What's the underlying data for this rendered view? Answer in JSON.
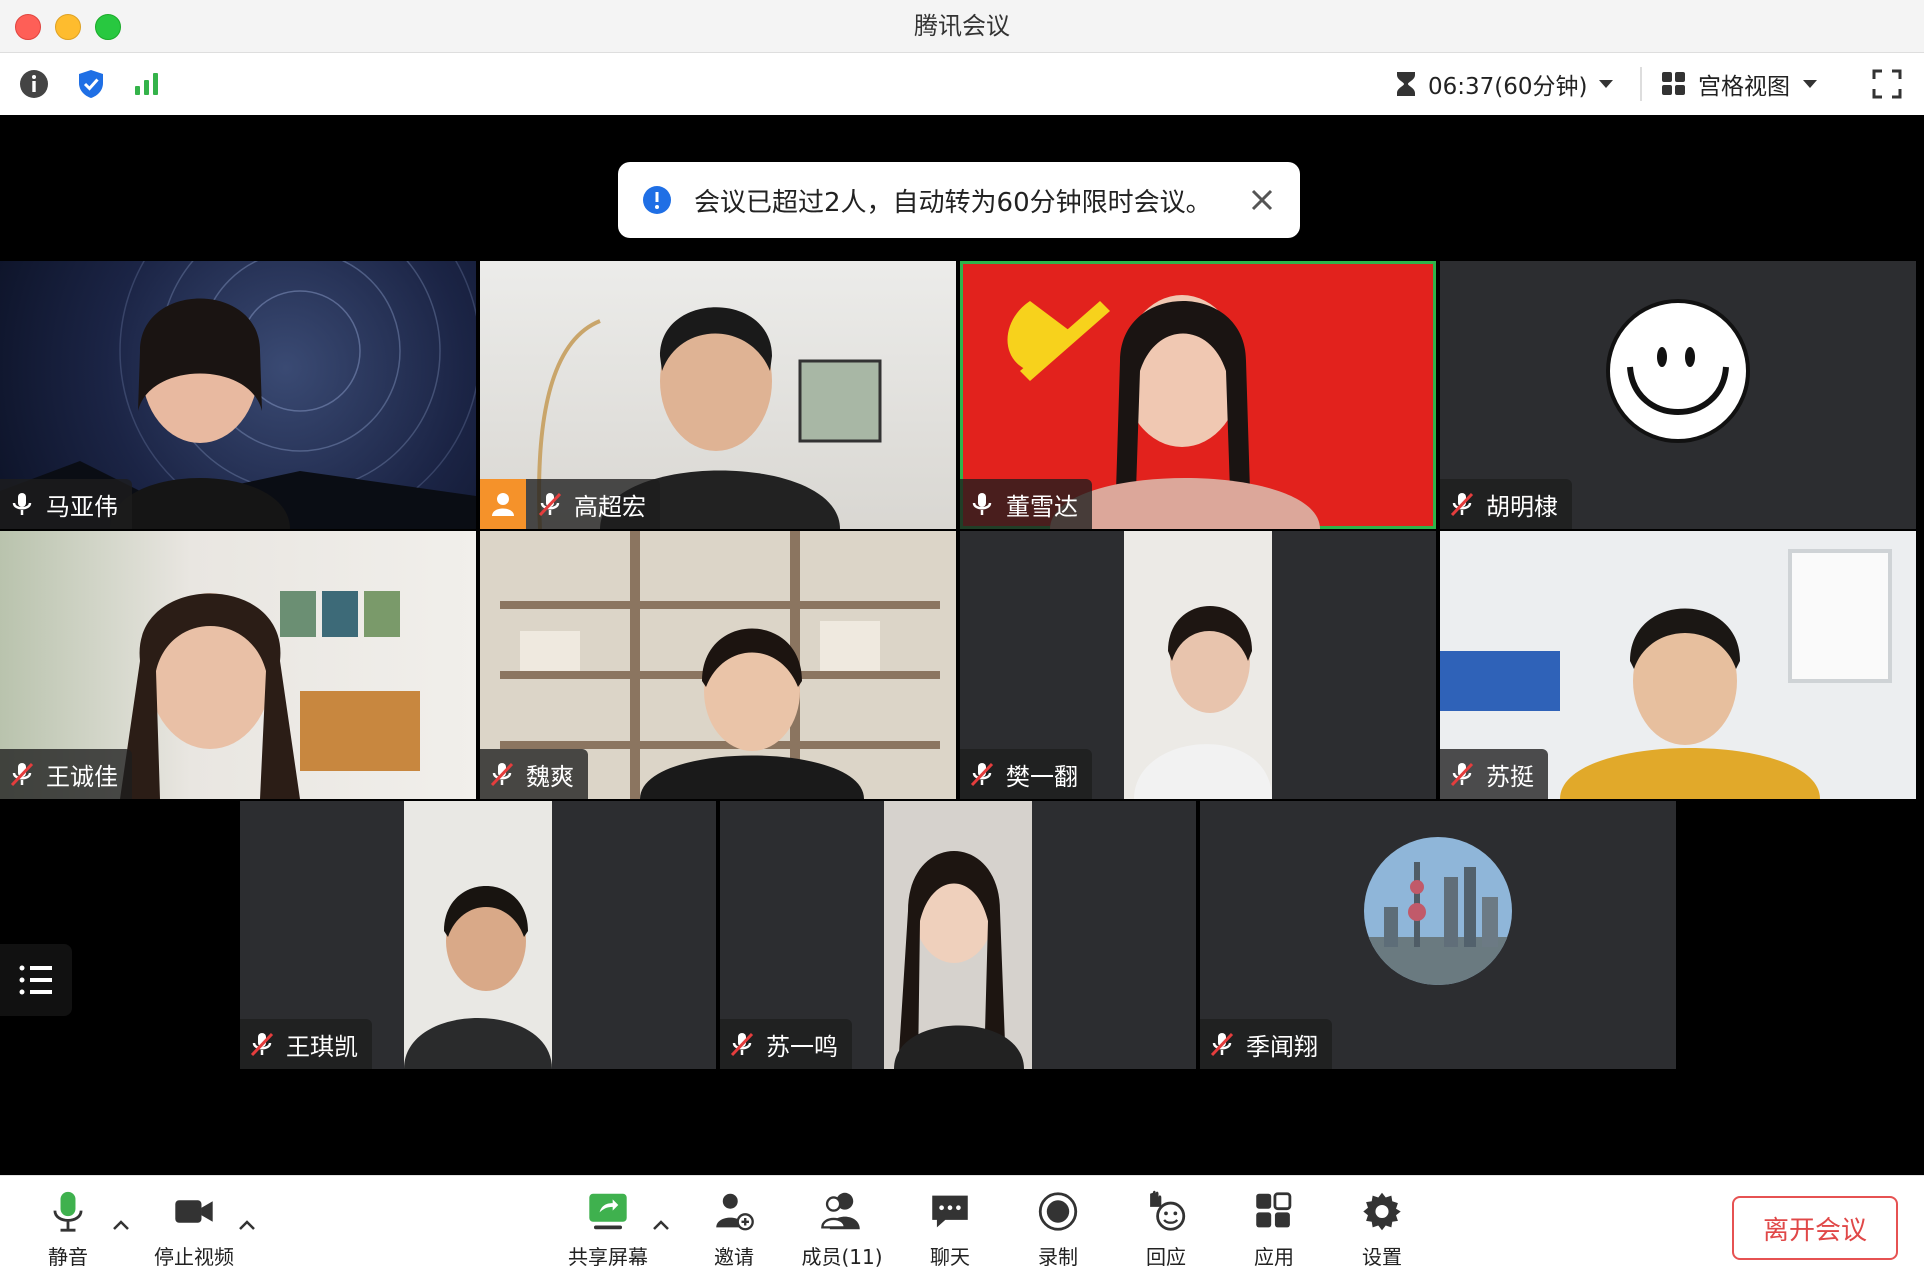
{
  "window": {
    "title": "腾讯会议"
  },
  "topbar": {
    "timer": "06:37(60分钟)",
    "view_mode": "宫格视图"
  },
  "notice": {
    "text": "会议已超过2人，自动转为60分钟限时会议。"
  },
  "participants": [
    {
      "name": "马亚伟",
      "mic": "on"
    },
    {
      "name": "高超宏",
      "mic": "muted"
    },
    {
      "name": "董雪达",
      "mic": "on",
      "speaking": true
    },
    {
      "name": "胡明棣",
      "mic": "muted"
    },
    {
      "name": "王诚佳",
      "mic": "muted"
    },
    {
      "name": "魏爽",
      "mic": "muted"
    },
    {
      "name": "樊一翻",
      "mic": "muted"
    },
    {
      "name": "苏挺",
      "mic": "muted"
    },
    {
      "name": "王琪凯",
      "mic": "muted"
    },
    {
      "name": "苏一鸣",
      "mic": "muted"
    },
    {
      "name": "季闻翔",
      "mic": "muted"
    }
  ],
  "toolbar": {
    "mute": "静音",
    "stop_video": "停止视频",
    "share_screen": "共享屏幕",
    "invite": "邀请",
    "members": "成员(11)",
    "chat": "聊天",
    "record": "录制",
    "react": "回应",
    "apps": "应用",
    "settings": "设置",
    "leave": "离开会议"
  },
  "colors": {
    "speaking_border": "#2fb34b",
    "leave_red": "#e04848",
    "accent_blue": "#1f6fe5"
  }
}
